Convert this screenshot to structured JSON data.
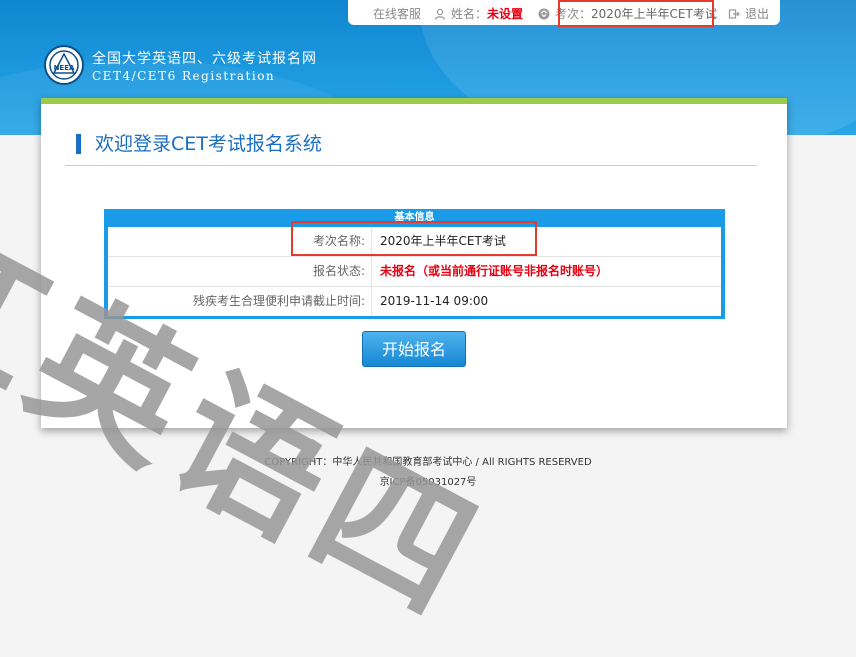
{
  "topbar": {
    "service_label": "在线客服",
    "name_label": "姓名：",
    "name_value": "未设置",
    "exam_label": "考次：",
    "exam_value": "2020年上半年CET考试",
    "logout_label": "退出"
  },
  "logo": {
    "title_cn": "全国大学英语四、六级考试报名网",
    "title_en": "CET4/CET6  Registration",
    "badge_text": "NEEA"
  },
  "main": {
    "title": "欢迎登录CET考试报名系统",
    "info_title": "基本信息",
    "rows": [
      {
        "label": "考次名称:",
        "value": "2020年上半年CET考试",
        "highlight": false
      },
      {
        "label": "报名状态:",
        "value": "未报名（或当前通行证账号非报名时账号）",
        "highlight": true
      },
      {
        "label": "残疾考生合理便利申请截止时间:",
        "value": "2019-11-14 09:00",
        "highlight": false
      }
    ],
    "start_button": "开始报名"
  },
  "footer": {
    "copyright": "COPYRIGHT：中华人民共和国教育部考试中心 / All RIGHTS RESERVED",
    "icp": "京ICP备05031027号"
  },
  "watermark": "江英语四",
  "colors": {
    "accent_blue": "#1a9be8",
    "title_blue": "#1a6fc2",
    "alert_red": "#e60012",
    "card_top_green": "#9ccb4b",
    "annotation_red": "#e63a2e"
  }
}
